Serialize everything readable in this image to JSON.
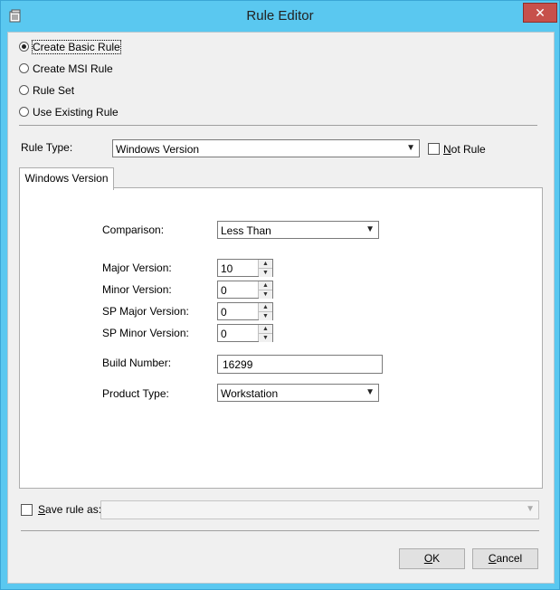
{
  "window": {
    "title": "Rule Editor",
    "close_glyph": "✕"
  },
  "radios": [
    {
      "label": "Create Basic Rule",
      "checked": true
    },
    {
      "label": "Create MSI Rule",
      "checked": false
    },
    {
      "label": "Rule Set",
      "checked": false
    },
    {
      "label": "Use Existing Rule",
      "checked": false
    }
  ],
  "rule_type": {
    "label": "Rule Type:",
    "value": "Windows Version",
    "not_rule": {
      "prefix": "",
      "accel": "N",
      "rest": "ot Rule",
      "checked": false
    }
  },
  "tab": {
    "label": "Windows Version"
  },
  "form": {
    "comparison": {
      "label": "Comparison:",
      "value": "Less Than"
    },
    "major": {
      "label": "Major Version:",
      "value": "10"
    },
    "minor": {
      "label": "Minor Version:",
      "value": "0"
    },
    "sp_major": {
      "label": "SP Major Version:",
      "value": "0"
    },
    "sp_minor": {
      "label": "SP Minor Version:",
      "value": "0"
    },
    "build": {
      "label": "Build Number:",
      "value": "16299"
    },
    "product": {
      "label": "Product Type:",
      "value": "Workstation"
    }
  },
  "save_rule": {
    "accel": "S",
    "rest": "ave rule as:",
    "checked": false,
    "value": ""
  },
  "buttons": {
    "ok_accel": "O",
    "ok_rest": "K",
    "cancel_accel": "C",
    "cancel_rest": "ancel"
  },
  "icons": {
    "app": "app-icon",
    "arrow": "chevron-down-icon"
  }
}
